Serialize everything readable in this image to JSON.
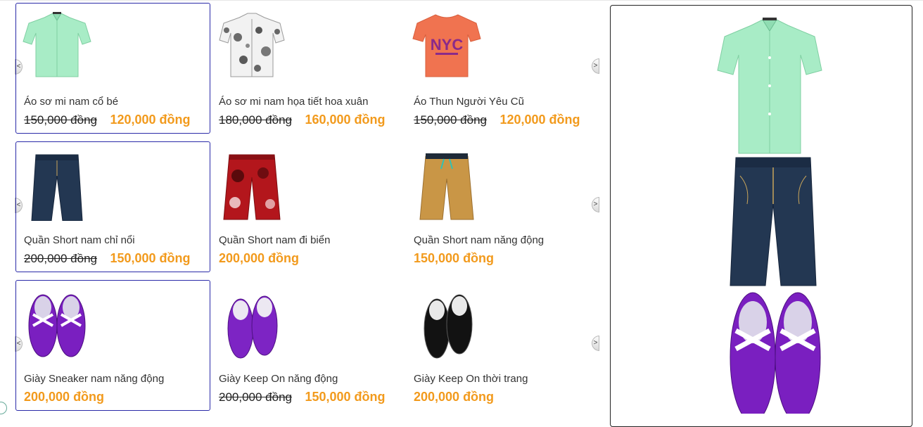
{
  "rows": [
    {
      "items": [
        {
          "name": "Áo sơ mi nam cổ bé",
          "old_price": "150,000 đồng",
          "price": "120,000 đồng",
          "image": "shirt-green-icon",
          "selected": true
        },
        {
          "name": "Áo sơ mi nam họa tiết hoa xuân",
          "old_price": "180,000 đồng",
          "price": "160,000 đồng",
          "image": "shirt-floral-icon",
          "selected": false
        },
        {
          "name": "Áo Thun Người Yêu Cũ",
          "old_price": "150,000 đồng",
          "price": "120,000 đồng",
          "image": "tshirt-nyc-icon",
          "selected": false
        }
      ]
    },
    {
      "items": [
        {
          "name": "Quần Short nam chỉ nổi",
          "old_price": "200,000 đồng",
          "price": "150,000 đồng",
          "image": "shorts-denim-icon",
          "selected": true
        },
        {
          "name": "Quần Short nam đi biển",
          "old_price": "",
          "price": "200,000 đồng",
          "image": "shorts-red-floral-icon",
          "selected": false
        },
        {
          "name": "Quần Short nam năng động",
          "old_price": "",
          "price": "150,000 đồng",
          "image": "shorts-khaki-icon",
          "selected": false
        }
      ]
    },
    {
      "items": [
        {
          "name": "Giày Sneaker nam năng động",
          "old_price": "",
          "price": "200,000 đồng",
          "image": "sneaker-purple-icon",
          "selected": true
        },
        {
          "name": "Giày Keep On năng động",
          "old_price": "200,000 đồng",
          "price": "150,000 đồng",
          "image": "slipon-purple-icon",
          "selected": false
        },
        {
          "name": "Giày Keep On thời trang",
          "old_price": "",
          "price": "200,000 đồng",
          "image": "slipon-black-icon",
          "selected": false
        }
      ]
    }
  ],
  "arrows": {
    "left": "<",
    "right": ">"
  },
  "colors": {
    "selected_border": "#2a2aa8",
    "price": "#f29a1c",
    "preview_border": "#222222"
  }
}
